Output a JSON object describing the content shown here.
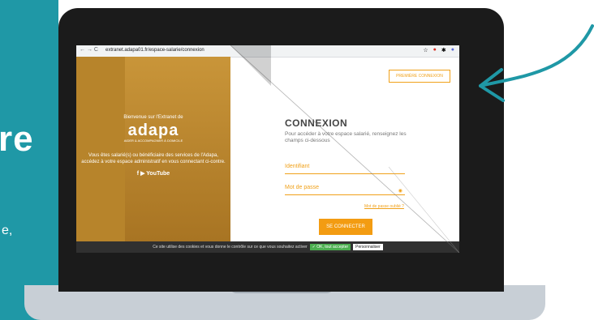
{
  "page": {
    "left_fragment": "re",
    "left_fragment2": "e,"
  },
  "browser": {
    "url": "extranet.adapa01.fr/espace-salarie/connexion",
    "nav_icons": "← → C"
  },
  "hero": {
    "welcome": "Bienvenue sur l'Extranet de",
    "logo": "adapa",
    "tagline": "AIDER & ACCOMPAGNER À DOMICILE",
    "description": "Vous êtes salarié(s) ou bénéficiaire des services de l'Adapa, accédez à votre espace administratif en vous connectant ci-contre.",
    "social": "f  ▶ YouTube"
  },
  "header": {
    "first_login": "PREMIÈRE CONNEXION"
  },
  "login": {
    "title": "CONNEXION",
    "subtitle": "Pour accéder à votre espace salarié, renseignez les champs ci-dessous",
    "identifier_placeholder": "Identifiant",
    "password_placeholder": "Mot de passe",
    "forgot": "Mot de passe oublié ?",
    "connect": "SE CONNECTER"
  },
  "cookies": {
    "text": "Ce site utilise des cookies et vous donne le contrôle sur ce que vous souhaitez activer",
    "accept": "✓ OK, tout accepter",
    "customize": "Personnaliser"
  },
  "colors": {
    "teal": "#1f98a6",
    "orange": "#f0a11a",
    "hero": "#b7842b"
  }
}
